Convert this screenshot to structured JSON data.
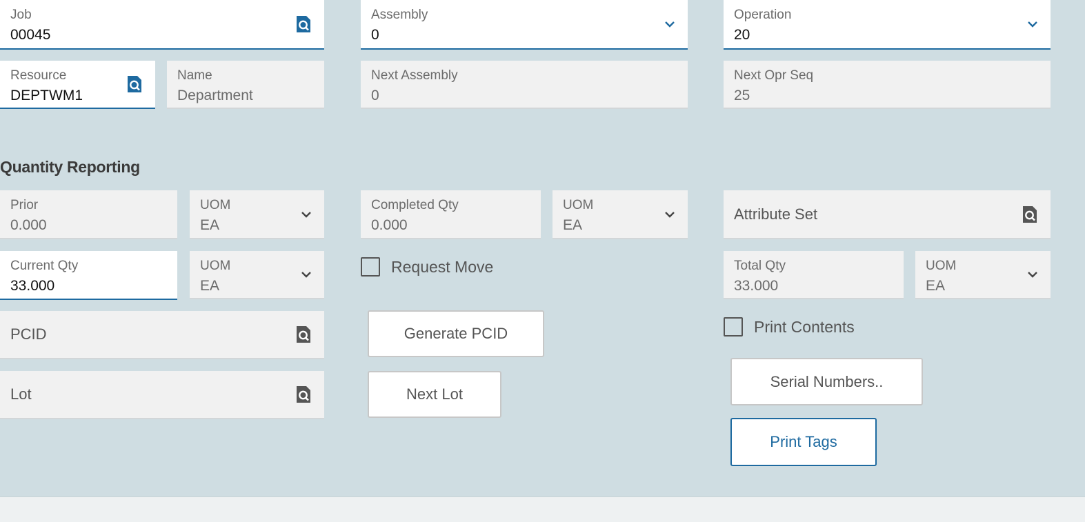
{
  "header": {
    "job": {
      "label": "Job",
      "value": "00045",
      "icon": "search-doc-icon"
    },
    "assembly": {
      "label": "Assembly",
      "value": "0"
    },
    "operation": {
      "label": "Operation",
      "value": "20"
    },
    "resource": {
      "label": "Resource",
      "value": "DEPTWM1",
      "icon": "search-doc-icon"
    },
    "name": {
      "label": "Name",
      "value": "Department"
    },
    "next_assembly": {
      "label": "Next Assembly",
      "value": "0"
    },
    "next_opr_seq": {
      "label": "Next Opr Seq",
      "value": "25"
    }
  },
  "quantity": {
    "title": "Quantity Reporting",
    "prior": {
      "label": "Prior",
      "value": "0.000"
    },
    "prior_uom": {
      "label": "UOM",
      "value": "EA"
    },
    "completed_qty": {
      "label": "Completed Qty",
      "value": "0.000"
    },
    "completed_uom": {
      "label": "UOM",
      "value": "EA"
    },
    "attribute_set": {
      "label": "Attribute Set"
    },
    "current_qty": {
      "label": "Current Qty",
      "value": "33.000"
    },
    "current_uom": {
      "label": "UOM",
      "value": "EA"
    },
    "request_move": {
      "label": "Request Move",
      "checked": false
    },
    "total_qty": {
      "label": "Total Qty",
      "value": "33.000"
    },
    "total_uom": {
      "label": "UOM",
      "value": "EA"
    },
    "pcid": {
      "label": "PCID"
    },
    "lot": {
      "label": "Lot"
    },
    "print_contents": {
      "label": "Print Contents",
      "checked": false
    }
  },
  "buttons": {
    "generate_pcid": "Generate PCID",
    "next_lot": "Next Lot",
    "serial_numbers": "Serial Numbers..",
    "print_tags": "Print Tags"
  },
  "colors": {
    "background": "#cfdde2",
    "accent": "#1e6aa0",
    "field_readonly": "#f1f1f1",
    "field_editable": "#ffffff"
  }
}
